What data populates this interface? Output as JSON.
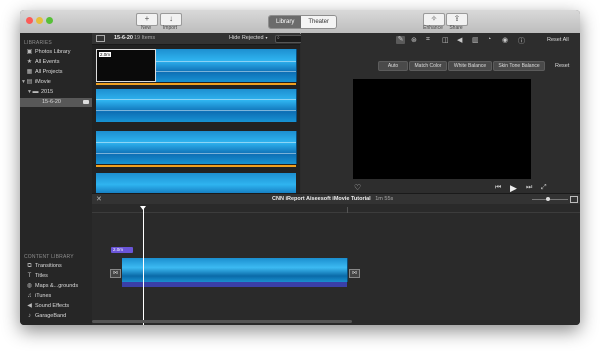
{
  "toolbar": {
    "new_label": "New",
    "import_label": "Import",
    "library_tab": "Library",
    "theater_tab": "Theater",
    "enhance_label": "Enhance",
    "share_label": "Share"
  },
  "sidebar": {
    "libraries_header": "LIBRARIES",
    "items": [
      {
        "label": "Photos Library",
        "icon": "photo-icon"
      },
      {
        "label": "All Events",
        "icon": "star-icon"
      },
      {
        "label": "All Projects",
        "icon": "grid-icon"
      },
      {
        "label": "iMovie",
        "icon": "film-icon"
      },
      {
        "label": "2015",
        "icon": "folder-icon"
      },
      {
        "label": "15-6-20",
        "icon": "event-icon"
      }
    ],
    "content_header": "CONTENT LIBRARY",
    "content_items": [
      {
        "label": "Transitions",
        "icon": "transition-icon"
      },
      {
        "label": "Titles",
        "icon": "titles-icon"
      },
      {
        "label": "Maps &...grounds",
        "icon": "globe-icon"
      },
      {
        "label": "iTunes",
        "icon": "music-icon"
      },
      {
        "label": "Sound Effects",
        "icon": "speaker-icon"
      },
      {
        "label": "GarageBand",
        "icon": "guitar-icon"
      }
    ]
  },
  "browser": {
    "event_name": "15-6-20",
    "item_count": "19 Items",
    "filter": "Hide Rejected",
    "first_clip_duration": "2.0m"
  },
  "viewer": {
    "reset_all": "Reset All",
    "reset": "Reset",
    "buttons": [
      "Auto",
      "Match Color",
      "White Balance",
      "Skin Tone Balance"
    ]
  },
  "timeline": {
    "project_title": "CNN iReport Aiseesoft iMovie Tutorial",
    "duration": "1m 55s",
    "clip_duration": "2.0m"
  },
  "colors": {
    "accent_orange": "#f0a020",
    "selection": "#585858",
    "playhead": "#ffffff",
    "audio": "#3a3fa8",
    "title_clip": "#6a55d8"
  }
}
